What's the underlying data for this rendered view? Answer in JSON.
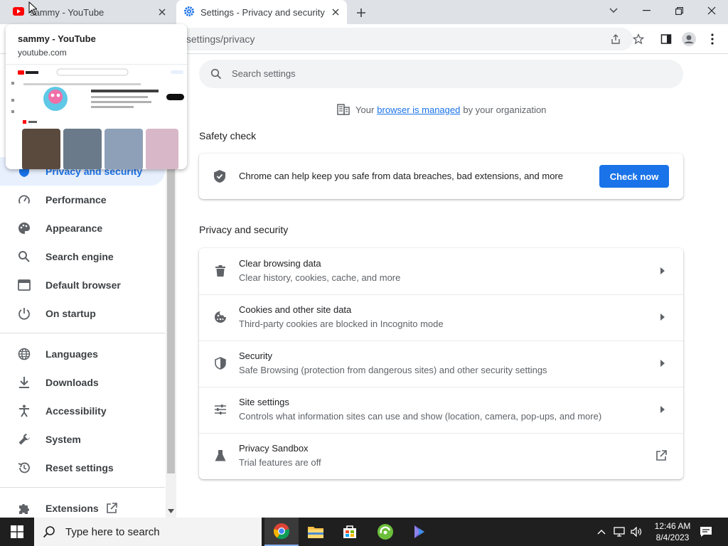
{
  "tabs": [
    {
      "title": "sammy - YouTube"
    },
    {
      "title": "Settings - Privacy and security"
    }
  ],
  "omnibox": {
    "url": "/settings/privacy"
  },
  "hovercard": {
    "title": "sammy - YouTube",
    "domain": "youtube.com"
  },
  "sidebar": {
    "items": [
      {
        "label": "Privacy and security"
      },
      {
        "label": "Performance"
      },
      {
        "label": "Appearance"
      },
      {
        "label": "Search engine"
      },
      {
        "label": "Default browser"
      },
      {
        "label": "On startup"
      },
      {
        "label": "Languages"
      },
      {
        "label": "Downloads"
      },
      {
        "label": "Accessibility"
      },
      {
        "label": "System"
      },
      {
        "label": "Reset settings"
      },
      {
        "label": "Extensions"
      }
    ]
  },
  "main": {
    "search_placeholder": "Search settings",
    "managed_prefix": "Your",
    "managed_link": "browser is managed",
    "managed_suffix": "by your organization",
    "safety_title": "Safety check",
    "safety_text": "Chrome can help keep you safe from data breaches, bad extensions, and more",
    "check_now": "Check now",
    "privacy_title": "Privacy and security",
    "rows": [
      {
        "title": "Clear browsing data",
        "subtitle": "Clear history, cookies, cache, and more"
      },
      {
        "title": "Cookies and other site data",
        "subtitle": "Third-party cookies are blocked in Incognito mode"
      },
      {
        "title": "Security",
        "subtitle": "Safe Browsing (protection from dangerous sites) and other security settings"
      },
      {
        "title": "Site settings",
        "subtitle": "Controls what information sites can use and show (location, camera, pop-ups, and more)"
      },
      {
        "title": "Privacy Sandbox",
        "subtitle": "Trial features are off"
      }
    ]
  },
  "taskbar": {
    "search_placeholder": "Type here to search",
    "time": "12:46 AM",
    "date": "8/4/2023"
  },
  "colors": {
    "accent": "#1a73e8",
    "tab_bg": "#dee1e6",
    "youtube_red": "#ff0000"
  }
}
